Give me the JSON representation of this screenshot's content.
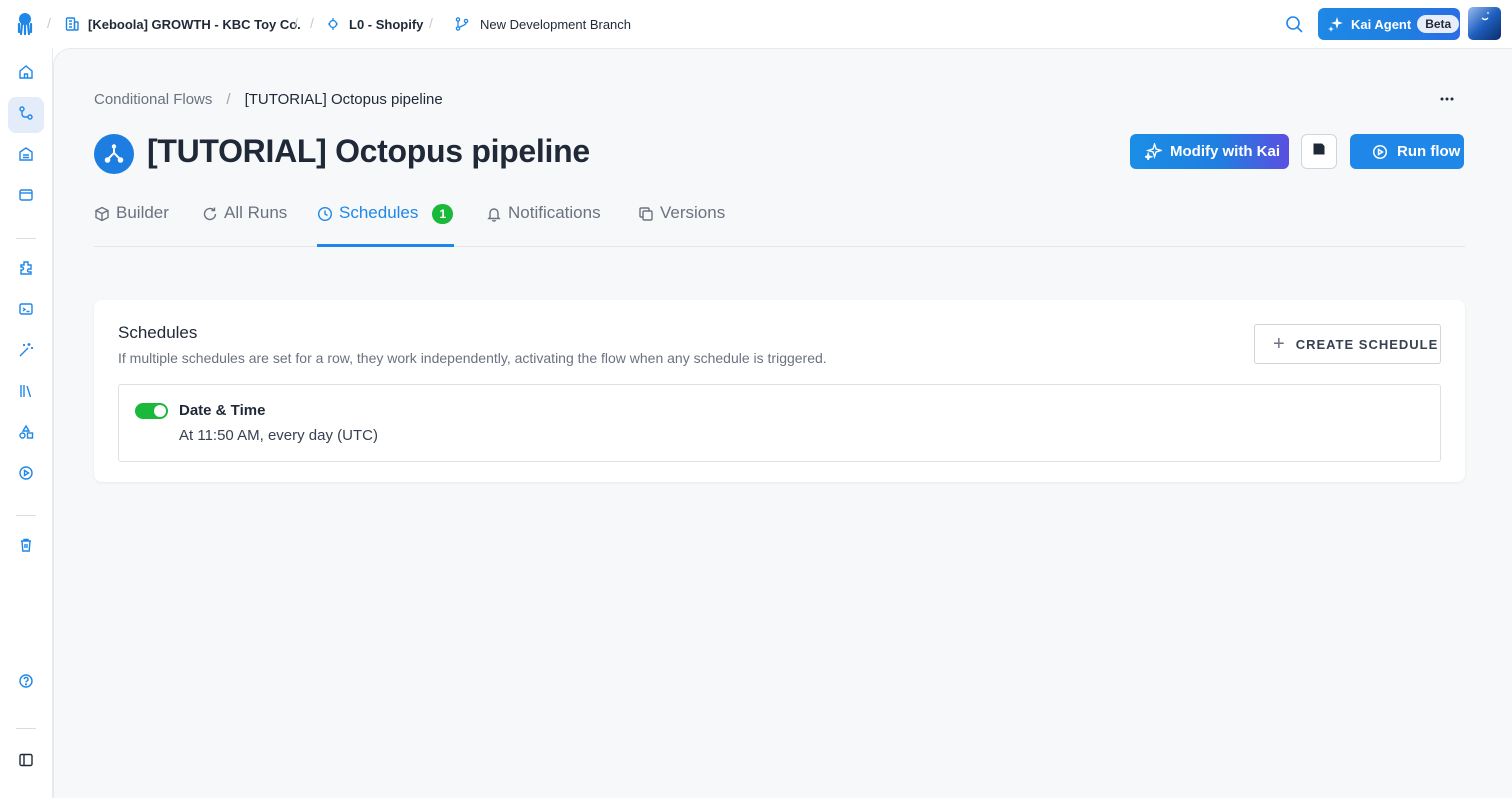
{
  "topbar": {
    "organization": "[Keboola] GROWTH - KBC Toy Co.",
    "project": "L0 - Shopify",
    "branch": "New Development Branch",
    "separator": "/",
    "kai_label": "Kai Agent",
    "kai_badge": "Beta",
    "icons": {
      "logo": "keboola-logo-icon",
      "organization": "building-icon",
      "project": "project-icon",
      "branch": "git-branch-icon",
      "search": "search-icon",
      "kai": "sparkles-icon"
    }
  },
  "sidebar": {
    "items": [
      {
        "name": "home-icon"
      },
      {
        "name": "flows-icon",
        "active": true
      },
      {
        "name": "storage-icon"
      },
      {
        "name": "workspace-icon"
      },
      {
        "name": "components-icon"
      },
      {
        "name": "transformations-icon"
      },
      {
        "name": "magic-wand-icon"
      },
      {
        "name": "library-icon"
      },
      {
        "name": "shapes-icon"
      },
      {
        "name": "jobs-play-icon"
      },
      {
        "name": "trash-icon"
      },
      {
        "name": "help-icon"
      },
      {
        "name": "sidebar-toggle-icon"
      }
    ]
  },
  "breadcrumb": {
    "parent": "Conditional Flows",
    "separator": "/",
    "current": "[TUTORIAL] Octopus pipeline"
  },
  "header": {
    "title": "[TUTORIAL] Octopus pipeline",
    "modify_label": "Modify with Kai",
    "run_label": "Run flow"
  },
  "tabs": [
    {
      "label": "Builder",
      "icon": "cube-icon"
    },
    {
      "label": "All Runs",
      "icon": "refresh-icon"
    },
    {
      "label": "Schedules",
      "icon": "clock-icon",
      "badge": "1",
      "active": true
    },
    {
      "label": "Notifications",
      "icon": "bell-icon"
    },
    {
      "label": "Versions",
      "icon": "copy-icon"
    }
  ],
  "schedules": {
    "title": "Schedules",
    "description": "If multiple schedules are set for a row, they work independently, activating the flow when any schedule is triggered.",
    "create_label": "CREATE SCHEDULE",
    "items": [
      {
        "type": "Date & Time",
        "description": "At 11:50 AM, every day (UTC)",
        "enabled": true
      }
    ]
  },
  "colors": {
    "accent": "#1f87e8",
    "success": "#1ab93a",
    "background": "#f7f8fa"
  }
}
